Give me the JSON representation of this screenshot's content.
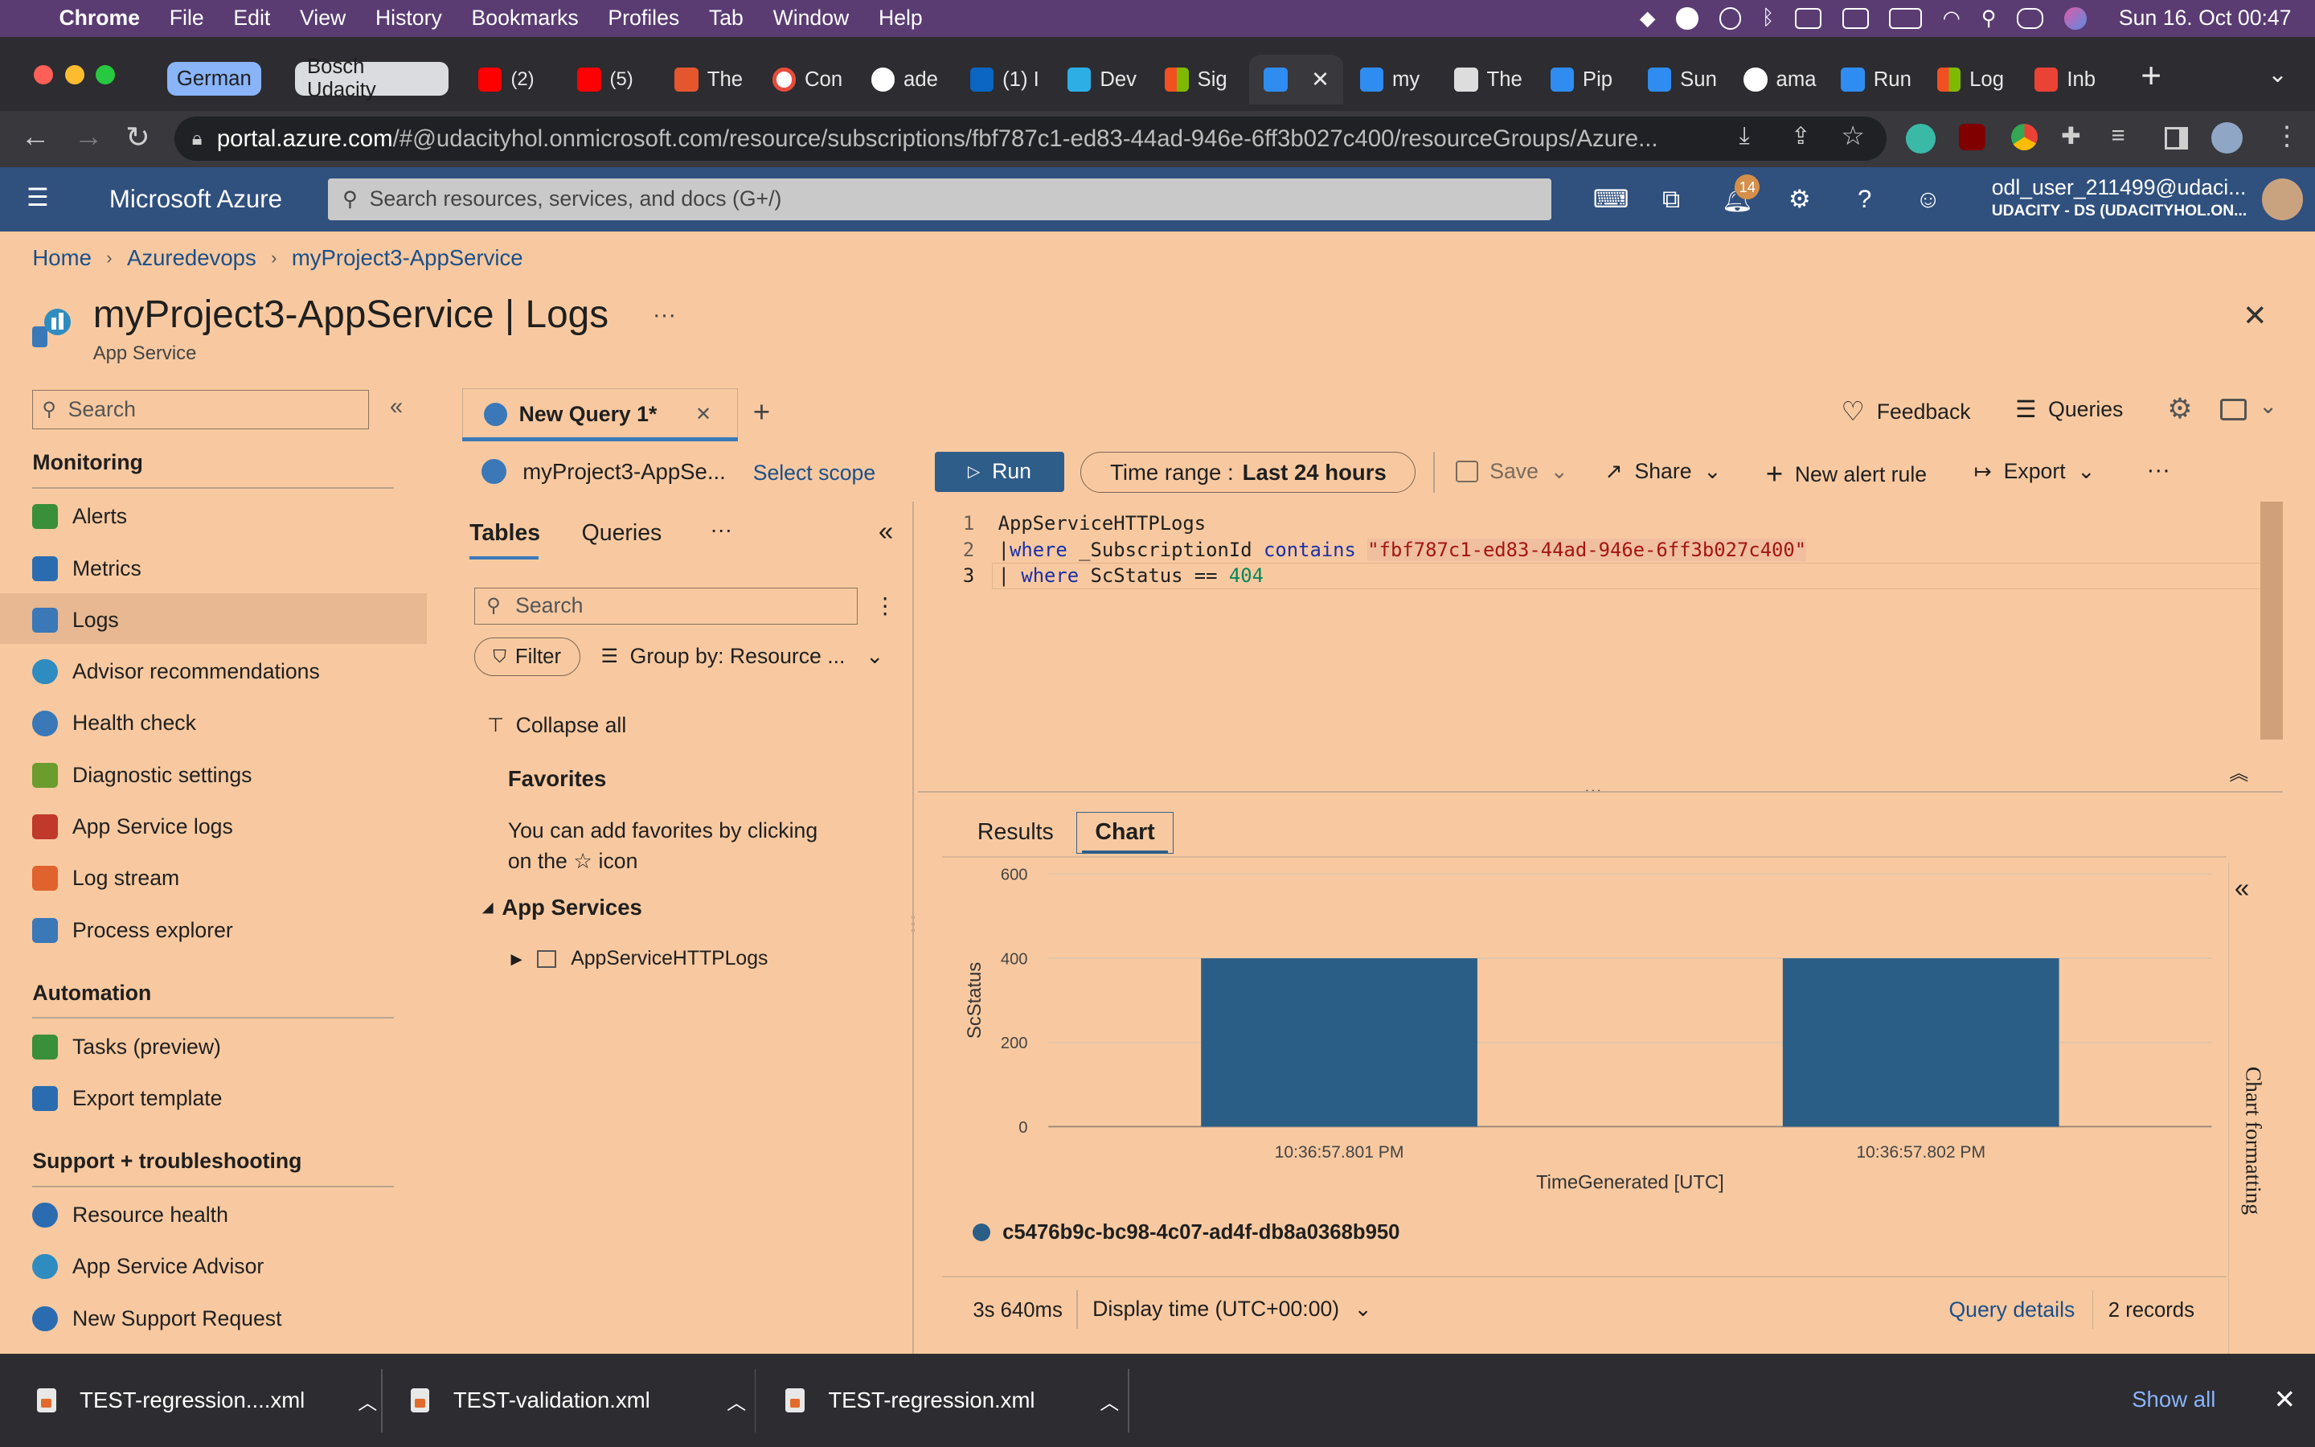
{
  "mac_menu": {
    "apple": "",
    "app_name": "Chrome",
    "items": [
      "File",
      "Edit",
      "View",
      "History",
      "Bookmarks",
      "Profiles",
      "Tab",
      "Window",
      "Help"
    ],
    "clock": "Sun 16. Oct  00:47"
  },
  "browser": {
    "tab_groups": [
      {
        "label": "German",
        "color": "#8ab4f8"
      },
      {
        "label": "Bosch Udacity",
        "color": "#dadce0"
      }
    ],
    "tabs": [
      {
        "label": "(2)",
        "icon": "youtube-icon",
        "color": "#ff0000"
      },
      {
        "label": "(5)",
        "icon": "youtube-icon",
        "color": "#ff0000"
      },
      {
        "label": "The",
        "icon": "document-icon",
        "color": "#e4572e"
      },
      {
        "label": "Con",
        "icon": "confluence-icon",
        "color": "#e74c3c"
      },
      {
        "label": "ade",
        "icon": "github-icon",
        "color": "#ffffff"
      },
      {
        "label": "(1) I",
        "icon": "linkedin-icon",
        "color": "#0a66c2"
      },
      {
        "label": "Dev",
        "icon": "udacity-icon",
        "color": "#2dafe6"
      },
      {
        "label": "Sig",
        "icon": "microsoft-icon",
        "color": "#f25022"
      },
      {
        "label": "",
        "icon": "azure-icon",
        "color": "#2f8cf0",
        "active": true
      },
      {
        "label": "my",
        "icon": "azure-icon",
        "color": "#2f8cf0"
      },
      {
        "label": "The",
        "icon": "document-icon",
        "color": "#dddddd"
      },
      {
        "label": "Pip",
        "icon": "azure-devops-icon",
        "color": "#2f8cf0"
      },
      {
        "label": "Sun",
        "icon": "azure-devops-icon",
        "color": "#2f8cf0"
      },
      {
        "label": "ama",
        "icon": "google-icon",
        "color": "#ffffff"
      },
      {
        "label": "Run",
        "icon": "azure-devops-icon",
        "color": "#2f8cf0"
      },
      {
        "label": "Log",
        "icon": "microsoft-icon",
        "color": "#f25022"
      },
      {
        "label": "Inb",
        "icon": "gmail-icon",
        "color": "#ea4335"
      }
    ],
    "url_host": "portal.azure.com",
    "url_rest": "/#@udacityhol.onmicrosoft.com/resource/subscriptions/fbf787c1-ed83-44ad-946e-6ff3b027c400/resourceGroups/Azure..."
  },
  "azure": {
    "brand": "Microsoft Azure",
    "search_placeholder": "Search resources, services, and docs (G+/)",
    "notifications_count": "14",
    "user_name": "odl_user_211499@udaci...",
    "user_org": "UDACITY - DS (UDACITYHOL.ON..."
  },
  "breadcrumb": [
    "Home",
    "Azuredevops",
    "myProject3-AppService"
  ],
  "page": {
    "title": "myProject3-AppService | Logs",
    "subtitle": "App Service"
  },
  "sidebar": {
    "search_placeholder": "Search",
    "sections": [
      {
        "title": "Monitoring",
        "items": [
          {
            "label": "Alerts",
            "icon": "alerts-icon",
            "color": "#3a8f3a"
          },
          {
            "label": "Metrics",
            "icon": "metrics-icon",
            "color": "#2b6cb0"
          },
          {
            "label": "Logs",
            "icon": "logs-icon",
            "color": "#3a78b8",
            "selected": true
          },
          {
            "label": "Advisor recommendations",
            "icon": "advisor-icon",
            "color": "#2f8cc0"
          },
          {
            "label": "Health check",
            "icon": "health-check-icon",
            "color": "#3a78b8"
          },
          {
            "label": "Diagnostic settings",
            "icon": "diagnostic-icon",
            "color": "#6a9c2e"
          },
          {
            "label": "App Service logs",
            "icon": "app-service-logs-icon",
            "color": "#c0392b"
          },
          {
            "label": "Log stream",
            "icon": "log-stream-icon",
            "color": "#e0622e"
          },
          {
            "label": "Process explorer",
            "icon": "process-explorer-icon",
            "color": "#3a78b8"
          }
        ]
      },
      {
        "title": "Automation",
        "items": [
          {
            "label": "Tasks (preview)",
            "icon": "tasks-icon",
            "color": "#3a8f3a"
          },
          {
            "label": "Export template",
            "icon": "export-template-icon",
            "color": "#2b6cb0"
          }
        ]
      },
      {
        "title": "Support + troubleshooting",
        "items": [
          {
            "label": "Resource health",
            "icon": "heart-icon",
            "color": "#2b6cb0"
          },
          {
            "label": "App Service Advisor",
            "icon": "advisor-bulb-icon",
            "color": "#2f8cc0"
          },
          {
            "label": "New Support Request",
            "icon": "support-icon",
            "color": "#2b6cb0"
          }
        ]
      }
    ]
  },
  "query_tab": {
    "label": "New Query 1*"
  },
  "top_actions": {
    "feedback": "Feedback",
    "queries": "Queries"
  },
  "toolbar": {
    "scope": "myProject3-AppSe...",
    "select_scope": "Select scope",
    "run": "Run",
    "time_range_label": "Time range :",
    "time_range_value": "Last 24 hours",
    "save": "Save",
    "share": "Share",
    "new_alert": "New alert rule",
    "export": "Export"
  },
  "schema_panel": {
    "tabs": [
      "Tables",
      "Queries"
    ],
    "search_placeholder": "Search",
    "filter": "Filter",
    "group_by": "Group by: Resource ...",
    "collapse_all": "Collapse all",
    "favorites_title": "Favorites",
    "favorites_hint_1": "You can add favorites by clicking",
    "favorites_hint_2": "on the",
    "favorites_hint_3": "icon",
    "group_title": "App Services",
    "table_name": "AppServiceHTTPLogs"
  },
  "editor": {
    "line1": "AppServiceHTTPLogs",
    "line2_kw1": "where",
    "line2_mid": " _SubscriptionId ",
    "line2_kw2": "contains",
    "line2_str": "\"fbf787c1-ed83-44ad-946e-6ff3b027c400\"",
    "line3_kw": "where",
    "line3_mid": " ScStatus == ",
    "line3_num": "404"
  },
  "results": {
    "tabs": [
      "Results",
      "Chart"
    ],
    "side_label": "Chart formatting",
    "duration": "3s 640ms",
    "display_time": "Display time (UTC+00:00)",
    "query_details": "Query details",
    "records": "2 records"
  },
  "chart_data": {
    "type": "bar",
    "categories": [
      "10:36:57.801 PM",
      "10:36:57.802 PM"
    ],
    "series": [
      {
        "name": "c5476b9c-bc98-4c07-ad4f-db8a0368b950",
        "values": [
          400,
          400
        ],
        "color": "#2b5e86"
      }
    ],
    "xlabel": "TimeGenerated [UTC]",
    "ylabel": "ScStatus",
    "ylim": [
      0,
      600
    ],
    "yticks": [
      0,
      200,
      400,
      600
    ]
  },
  "downloads": {
    "items": [
      "TEST-regression....xml",
      "TEST-validation.xml",
      "TEST-regression.xml"
    ],
    "show_all": "Show all"
  }
}
